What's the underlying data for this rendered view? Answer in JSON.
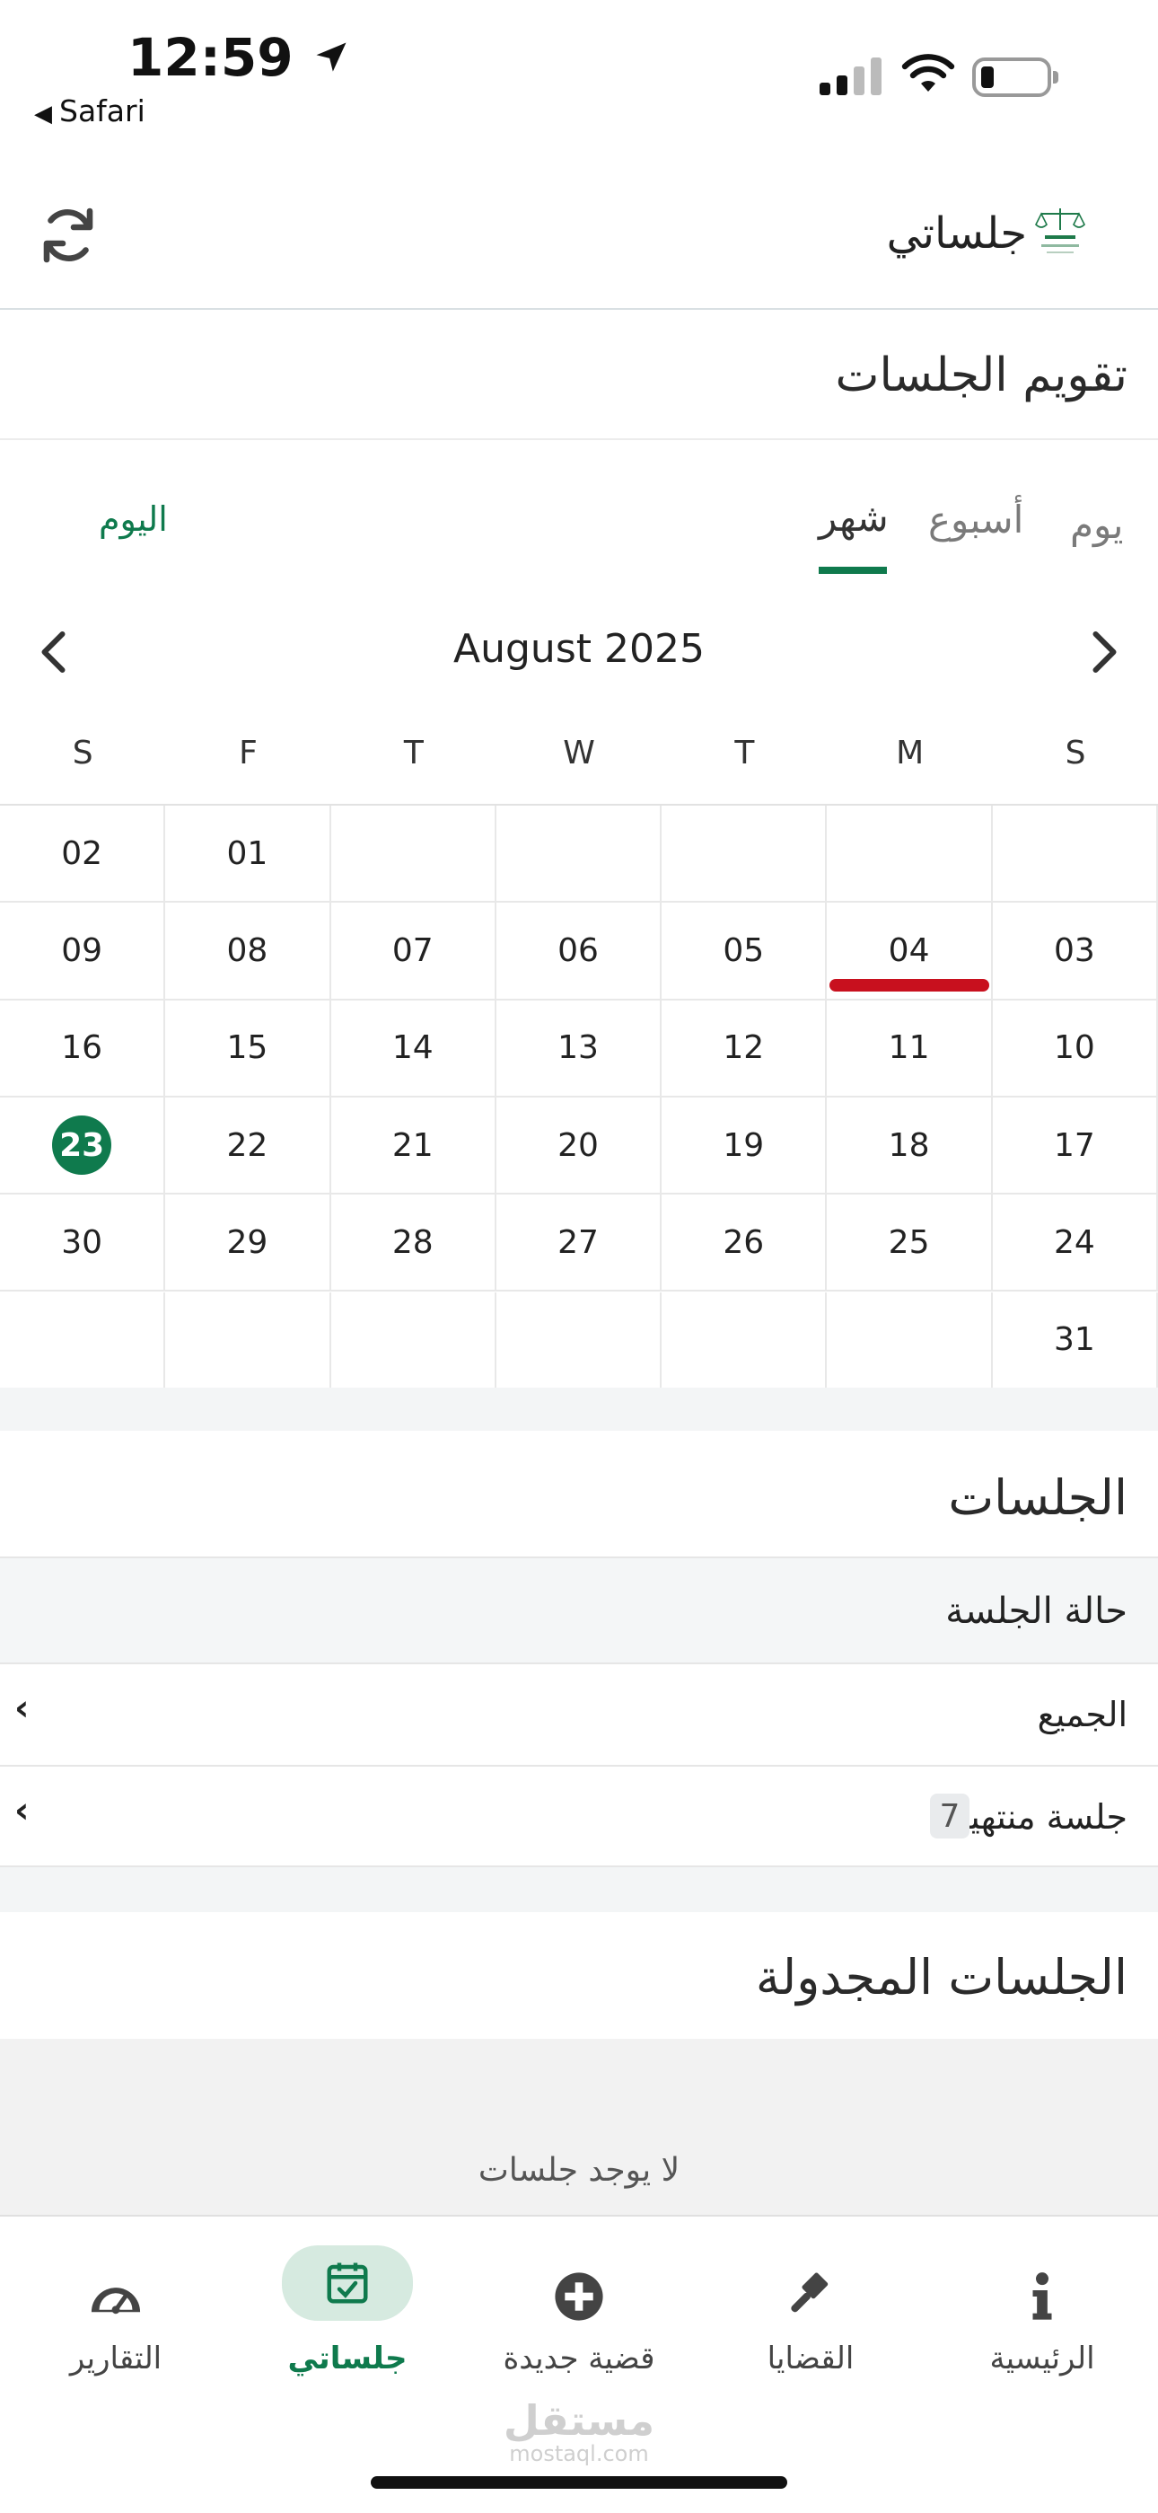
{
  "status_bar": {
    "time": "12:59",
    "back_app": "Safari"
  },
  "header": {
    "title": "جلساتي"
  },
  "calendar_section": {
    "title": "تقويم الجلسات",
    "view_tabs": [
      {
        "label": "يوم",
        "active": false
      },
      {
        "label": "أسبوع",
        "active": false
      },
      {
        "label": "شهر",
        "active": true
      }
    ],
    "today_label": "اليوم",
    "month_label": "August 2025",
    "weekdays": [
      "S",
      "M",
      "T",
      "W",
      "T",
      "F",
      "S"
    ],
    "weeks": [
      [
        "",
        "",
        "",
        "",
        "",
        "01",
        "02"
      ],
      [
        "03",
        "04",
        "05",
        "06",
        "07",
        "08",
        "09"
      ],
      [
        "10",
        "11",
        "12",
        "13",
        "14",
        "15",
        "16"
      ],
      [
        "17",
        "18",
        "19",
        "20",
        "21",
        "22",
        "23"
      ],
      [
        "24",
        "25",
        "26",
        "27",
        "28",
        "29",
        "30"
      ],
      [
        "31",
        "",
        "",
        "",
        "",
        "",
        ""
      ]
    ],
    "today_day": "23",
    "event_day": "04",
    "event_color": "#c8101e",
    "accent_color": "#0f7a4d"
  },
  "sessions": {
    "title": "الجلسات",
    "status_header": "حالة الجلسة",
    "filters": [
      {
        "label": "الجميع",
        "count": ""
      },
      {
        "label": "جلسة منتهية",
        "count": "7"
      }
    ]
  },
  "scheduled": {
    "title": "الجلسات المجدولة",
    "empty_text": "لا يوجد جلسات"
  },
  "bottom_nav": {
    "items": [
      {
        "label": "الرئيسية",
        "icon": "info-icon",
        "active": false
      },
      {
        "label": "القضايا",
        "icon": "gavel-icon",
        "active": false
      },
      {
        "label": "قضية جديدة",
        "icon": "add-circle-icon",
        "active": false
      },
      {
        "label": "جلساتي",
        "icon": "calendar-check-icon",
        "active": true
      },
      {
        "label": "التقارير",
        "icon": "dashboard-icon",
        "active": false
      }
    ]
  },
  "watermark": {
    "line1": "مستقل",
    "line2": "mostaql.com"
  }
}
